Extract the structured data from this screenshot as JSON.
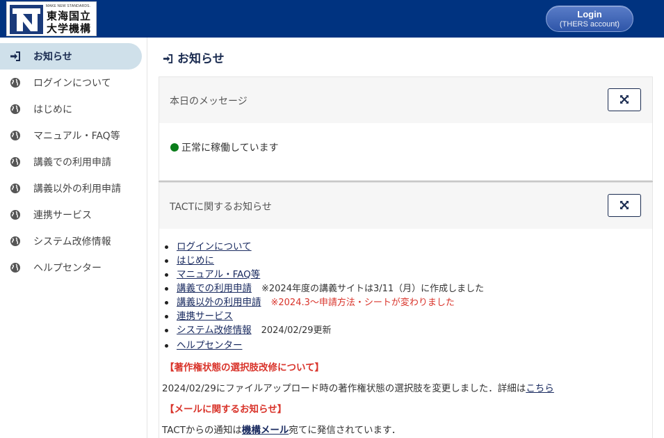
{
  "header": {
    "logo_tagline": "MAKE NEW STANDARDS.",
    "logo_name_line1": "東海国立",
    "logo_name_line2": "大学機構",
    "login_label": "Login",
    "login_sublabel": "(THERS account)",
    "bg_color": "#003380"
  },
  "sidebar": {
    "items": [
      {
        "label": "お知らせ",
        "icon": "sign-in-icon",
        "active": true
      },
      {
        "label": "ログインについて",
        "icon": "globe-icon"
      },
      {
        "label": "はじめに",
        "icon": "globe-icon"
      },
      {
        "label": "マニュアル・FAQ等",
        "icon": "globe-icon"
      },
      {
        "label": "講義での利用申請",
        "icon": "globe-icon"
      },
      {
        "label": "講義以外の利用申請",
        "icon": "globe-icon"
      },
      {
        "label": "連携サービス",
        "icon": "globe-icon"
      },
      {
        "label": "システム改修情報",
        "icon": "globe-icon"
      },
      {
        "label": "ヘルプセンター",
        "icon": "globe-icon"
      }
    ]
  },
  "main": {
    "page_title": "お知らせ",
    "message_card": {
      "title": "本日のメッセージ",
      "status_text": "正常に稼働しています",
      "status_color": "#0a7d1a"
    },
    "notice_card": {
      "title": "TACTに関するお知らせ",
      "links": [
        {
          "label": "ログインについて",
          "note": "",
          "note_style": ""
        },
        {
          "label": "はじめに",
          "note": "",
          "note_style": ""
        },
        {
          "label": "マニュアル・FAQ等",
          "note": "",
          "note_style": ""
        },
        {
          "label": "講義での利用申請",
          "note": "※2024年度の講義サイトは3/11（月）に作成しました",
          "note_style": "normal"
        },
        {
          "label": "講義以外の利用申請",
          "note": "※2024.3～申請方法・シートが変わりました",
          "note_style": "red"
        },
        {
          "label": "連携サービス",
          "note": "",
          "note_style": ""
        },
        {
          "label": "システム改修情報",
          "note": "2024/02/29更新",
          "note_style": "normal"
        },
        {
          "label": "ヘルプセンター",
          "note": "",
          "note_style": ""
        }
      ],
      "section1_heading": "【著作権状態の選択肢改修について】",
      "section1_text": "2024/02/29にファイルアップロード時の著作権状態の選択肢を変更しました．詳細は",
      "section1_link": "こちら",
      "section2_heading": "【メールに関するお知らせ】",
      "section2_text_before": "TACTからの通知は",
      "section2_link": "機構メール",
      "section2_text_after": "宛てに発信されています．",
      "accent_red": "#d9342b"
    }
  }
}
